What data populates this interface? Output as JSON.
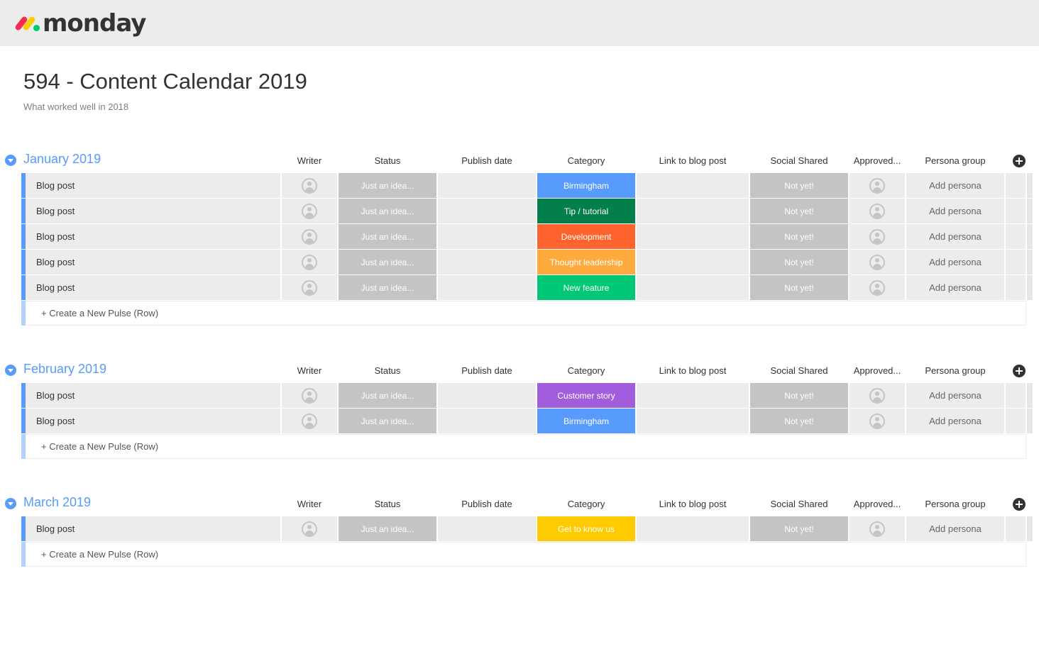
{
  "brand": {
    "name": "monday"
  },
  "board": {
    "title": "594 - Content Calendar 2019",
    "description": "What worked well in 2018"
  },
  "columns": {
    "writer": "Writer",
    "status": "Status",
    "publish_date": "Publish date",
    "category": "Category",
    "link": "Link to blog post",
    "social": "Social Shared",
    "approved": "Approved...",
    "persona": "Persona group"
  },
  "colors": {
    "group_accent": "#579bfc",
    "status_grey": "#c4c4c4",
    "cat_birmingham": "#579bfc",
    "cat_tip": "#037f4c",
    "cat_development": "#ff642e",
    "cat_thought": "#fdab3d",
    "cat_feature": "#00c875",
    "cat_customer": "#a25ddc",
    "cat_getknow": "#ffcb00"
  },
  "groups": [
    {
      "title": "January 2019",
      "new_row_label": "+ Create a New Pulse (Row)",
      "rows": [
        {
          "name": "Blog post",
          "status": "Just an idea...",
          "category": "Birmingham",
          "category_color": "#579bfc",
          "social": "Not yet!",
          "persona": "Add persona"
        },
        {
          "name": "Blog post",
          "status": "Just an idea...",
          "category": "Tip / tutorial",
          "category_color": "#037f4c",
          "social": "Not yet!",
          "persona": "Add persona"
        },
        {
          "name": "Blog post",
          "status": "Just an idea...",
          "category": "Development",
          "category_color": "#ff642e",
          "social": "Not yet!",
          "persona": "Add persona"
        },
        {
          "name": "Blog post",
          "status": "Just an idea...",
          "category": "Thought leadership",
          "category_color": "#fdab3d",
          "social": "Not yet!",
          "persona": "Add persona"
        },
        {
          "name": "Blog post",
          "status": "Just an idea...",
          "category": "New feature",
          "category_color": "#00c875",
          "social": "Not yet!",
          "persona": "Add persona"
        }
      ]
    },
    {
      "title": "February 2019",
      "new_row_label": "+ Create a New Pulse (Row)",
      "rows": [
        {
          "name": "Blog post",
          "status": "Just an idea...",
          "category": "Customer story",
          "category_color": "#a25ddc",
          "social": "Not yet!",
          "persona": "Add persona"
        },
        {
          "name": "Blog post",
          "status": "Just an idea...",
          "category": "Birmingham",
          "category_color": "#579bfc",
          "social": "Not yet!",
          "persona": "Add persona"
        }
      ]
    },
    {
      "title": "March 2019",
      "new_row_label": "+ Create a New Pulse (Row)",
      "rows": [
        {
          "name": "Blog post",
          "status": "Just an idea...",
          "category": "Get to know us",
          "category_color": "#ffcb00",
          "social": "Not yet!",
          "persona": "Add persona"
        }
      ]
    }
  ]
}
